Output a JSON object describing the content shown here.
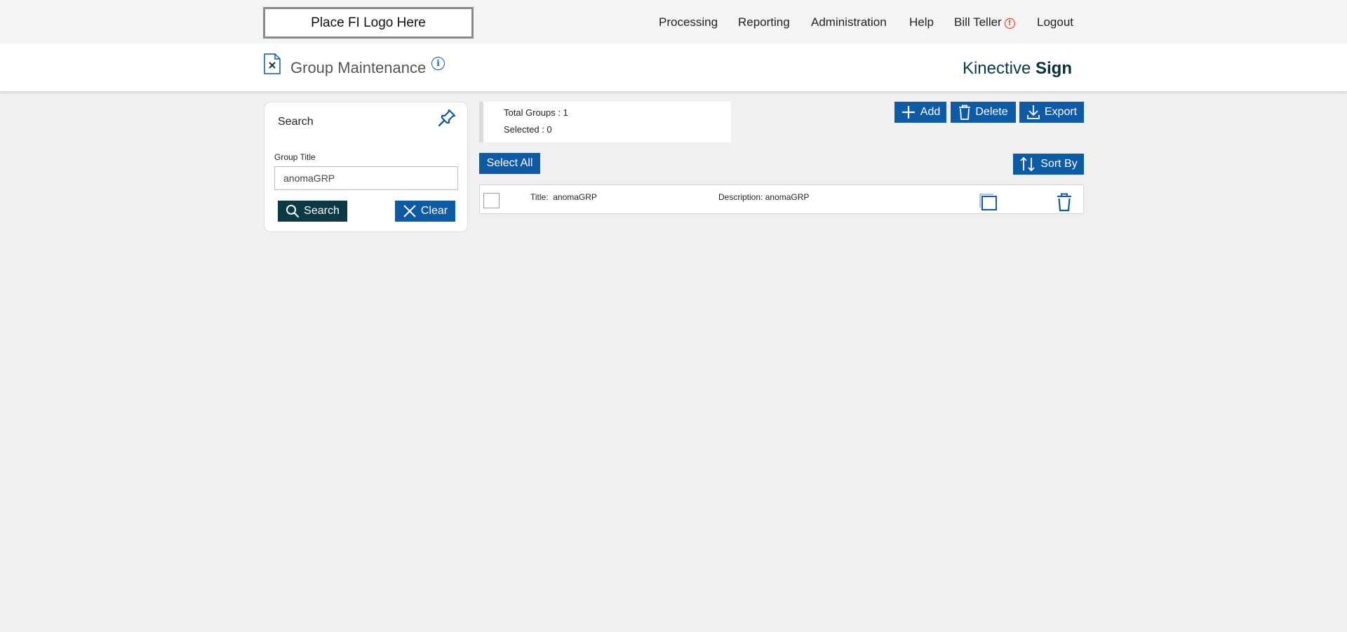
{
  "header": {
    "logo_text": "Place FI Logo Here",
    "nav": [
      {
        "label": "Processing"
      },
      {
        "label": "Reporting"
      },
      {
        "label": "Administration"
      },
      {
        "label": "Help"
      },
      {
        "label": "Bill Teller"
      },
      {
        "label": "Logout"
      }
    ],
    "alert_glyph": "!"
  },
  "page": {
    "title": "Group Maintenance",
    "info_glyph": "i",
    "brand_prefix": "Kinective",
    "brand_bold": "Sign"
  },
  "search": {
    "title": "Search",
    "field_label": "Group Title",
    "field_value": "anomaGRP",
    "search_button": "Search",
    "clear_button": "Clear"
  },
  "summary": {
    "total_label": "Total Groups : 1",
    "selected_label": "Selected : 0"
  },
  "toolbar": {
    "add": "Add",
    "delete": "Delete",
    "export": "Export",
    "select_all": "Select All",
    "sort_by": "Sort By"
  },
  "rows": [
    {
      "title_label": "Title:",
      "title": "anomaGRP",
      "description_label": "Description:",
      "description": "anomaGRP"
    }
  ],
  "colors": {
    "primary_blue": "#0f5aa5",
    "dark_teal": "#0b3a44",
    "alert_red": "#e02020",
    "background": "#f0f0f0"
  },
  "icons": [
    "document-icon",
    "info-icon",
    "pin-icon",
    "search-icon",
    "close-icon",
    "plus-icon",
    "trash-icon",
    "download-icon",
    "sort-icon",
    "copy-icon",
    "alert-icon"
  ]
}
